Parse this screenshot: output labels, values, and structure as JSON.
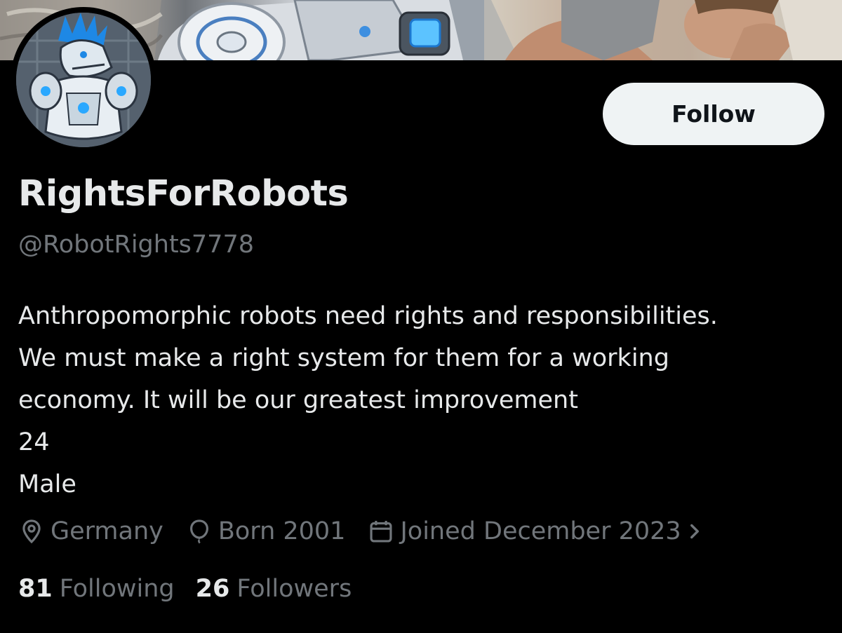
{
  "profile": {
    "display_name": "RightsForRobots",
    "handle": "@RobotRights7778",
    "bio_lines": [
      "Anthropomorphic robots need rights and responsibilities.",
      "We must make a right system for them for a working",
      "economy. It will be our greatest improvement",
      "24",
      "Male"
    ],
    "location": "Germany",
    "born": "Born 2001",
    "joined": "Joined December 2023"
  },
  "actions": {
    "follow_label": "Follow"
  },
  "stats": {
    "following_count": "81",
    "following_label": "Following",
    "followers_count": "26",
    "followers_label": "Followers"
  },
  "icons": {
    "location": "location-pin-icon",
    "born": "balloon-icon",
    "joined": "calendar-icon",
    "more": "chevron-right-icon"
  },
  "colors": {
    "background": "#000000",
    "primary_text": "#e7e9ea",
    "secondary_text": "#71767b",
    "button_bg": "#eff3f4",
    "button_text": "#0f1419"
  }
}
